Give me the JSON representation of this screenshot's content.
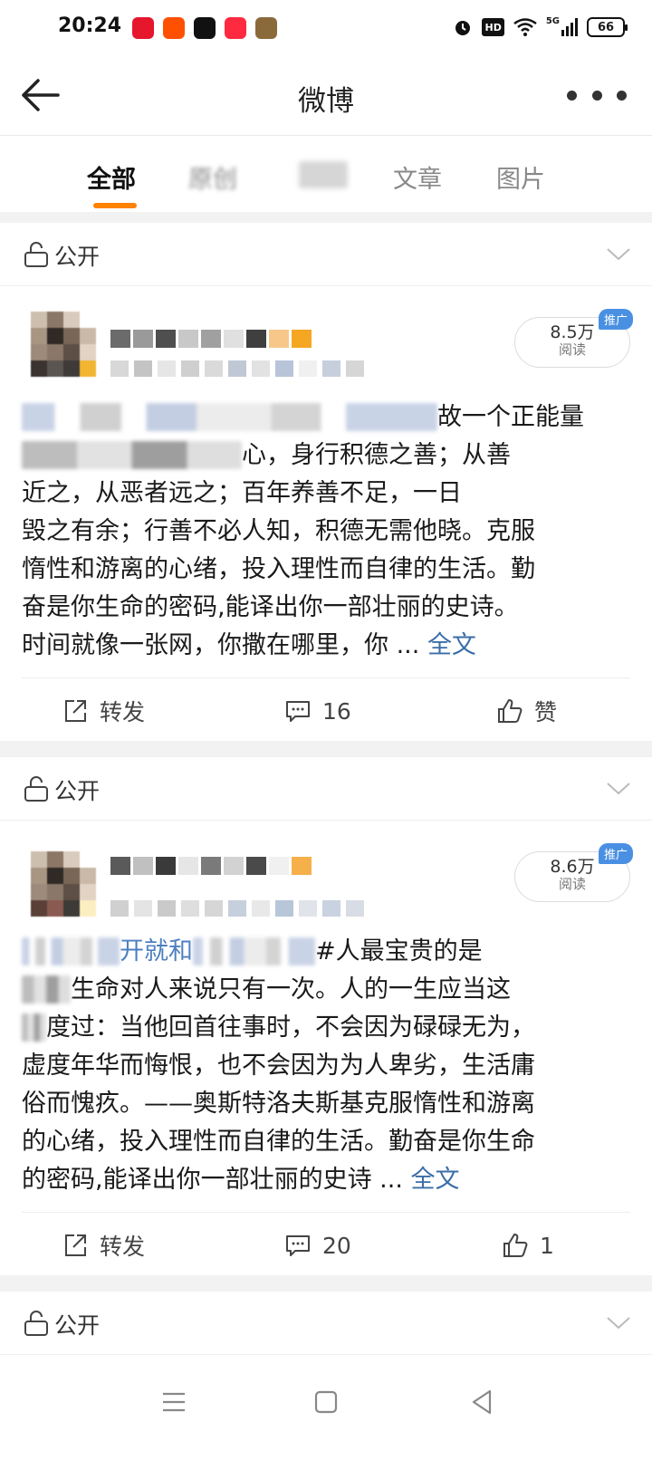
{
  "status_bar": {
    "time": "20:24",
    "apps": [
      {
        "icon": "weibo-app-icon",
        "color": "#e6162d"
      },
      {
        "icon": "kuaishou-app-icon",
        "color": "#ff5000"
      },
      {
        "icon": "tiktok-app-icon",
        "color": "#111111"
      },
      {
        "icon": "news-app-icon",
        "color": "#ff2a3f"
      },
      {
        "icon": "game-app-icon",
        "color": "#8a6a3a"
      }
    ],
    "network_label": "5G",
    "hd_label": "HD",
    "battery": "66"
  },
  "header": {
    "title": "微博"
  },
  "tabs": [
    {
      "label": "全部",
      "active": true
    },
    {
      "label": "原创",
      "active": false
    },
    {
      "label": "",
      "active": false
    },
    {
      "label": "文章",
      "active": false
    },
    {
      "label": "图片",
      "active": false
    }
  ],
  "accent_color": "#ff8200",
  "posts": [
    {
      "visibility": "公开",
      "reads": "8.5万",
      "reads_label": "阅读",
      "promo": "推广",
      "text_visible": "故一个正能量",
      "body_lines": [
        "心，身行积德之善；从善",
        "近之，从恶者远之；百年养善不足，一日",
        "毁之有余；行善不必人知，积德无需他晓。克服",
        "惰性和游离的心绪，投入理性而自律的生活。勤",
        "奋是你生命的密码,能译出你一部壮丽的史诗。",
        "时间就像一张网，你撒在哪里，你 ..."
      ],
      "full_text_link": "全文",
      "repost_label": "转发",
      "comments": "16",
      "like_label": "赞"
    },
    {
      "visibility": "公开",
      "reads": "8.6万",
      "reads_label": "阅读",
      "promo": "推广",
      "link_text": "开就和",
      "text_visible": "#人最宝贵的是",
      "body_lines": [
        "生命对人来说只有一次。人的一生应当这",
        "度过：当他回首往事时，不会因为碌碌无为，",
        "虚度年华而悔恨，也不会因为为人卑劣，生活庸",
        "俗而愧疚。——奥斯特洛夫斯基克服惰性和游离",
        "的心绪，投入理性而自律的生活。勤奋是你生命",
        "的密码,能译出你一部壮丽的史诗 ..."
      ],
      "full_text_link": "全文",
      "repost_label": "转发",
      "comments": "20",
      "likes": "1"
    },
    {
      "visibility": "公开"
    }
  ]
}
